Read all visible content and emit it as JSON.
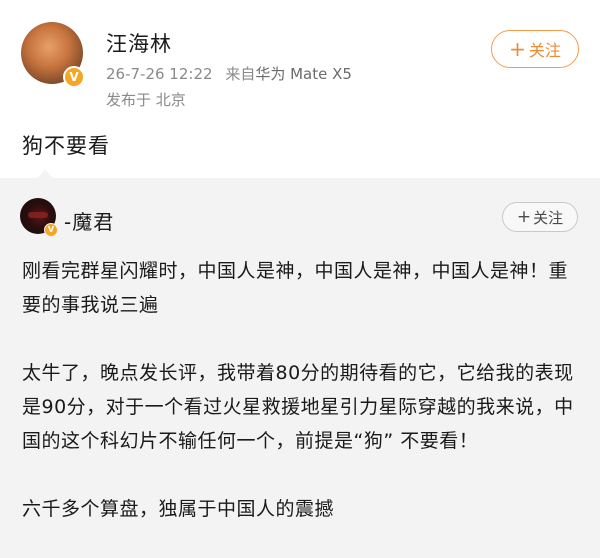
{
  "post": {
    "username": "汪海林",
    "verified_badge": "V",
    "timestamp": "26-7-26 12:22",
    "source_prefix": "来自",
    "device": "华为 Mate X5",
    "location": "发布于 北京",
    "follow_icon": "+",
    "follow_label": "关注",
    "text": "狗不要看"
  },
  "repost": {
    "username": "-魔君",
    "verified_badge": "V",
    "follow_icon": "+",
    "follow_label": "关注",
    "paragraphs": [
      "刚看完群星闪耀时，中国人是神，中国人是神，中国人是神！重要的事我说三遍",
      "太牛了，晚点发长评，我带着80分的期待看的它，它给我的表现是90分，对于一个看过火星救援地星引力星际穿越的我来说，中国的这个科幻片不输任何一个，前提是“狗” 不要看！",
      "六千多个算盘，独属于中国人的震撼"
    ]
  },
  "colors": {
    "accent": "#f08a33",
    "badge": "#f5a623",
    "repost_bg": "#f3f3f3",
    "meta_text": "#8a8a8a"
  }
}
